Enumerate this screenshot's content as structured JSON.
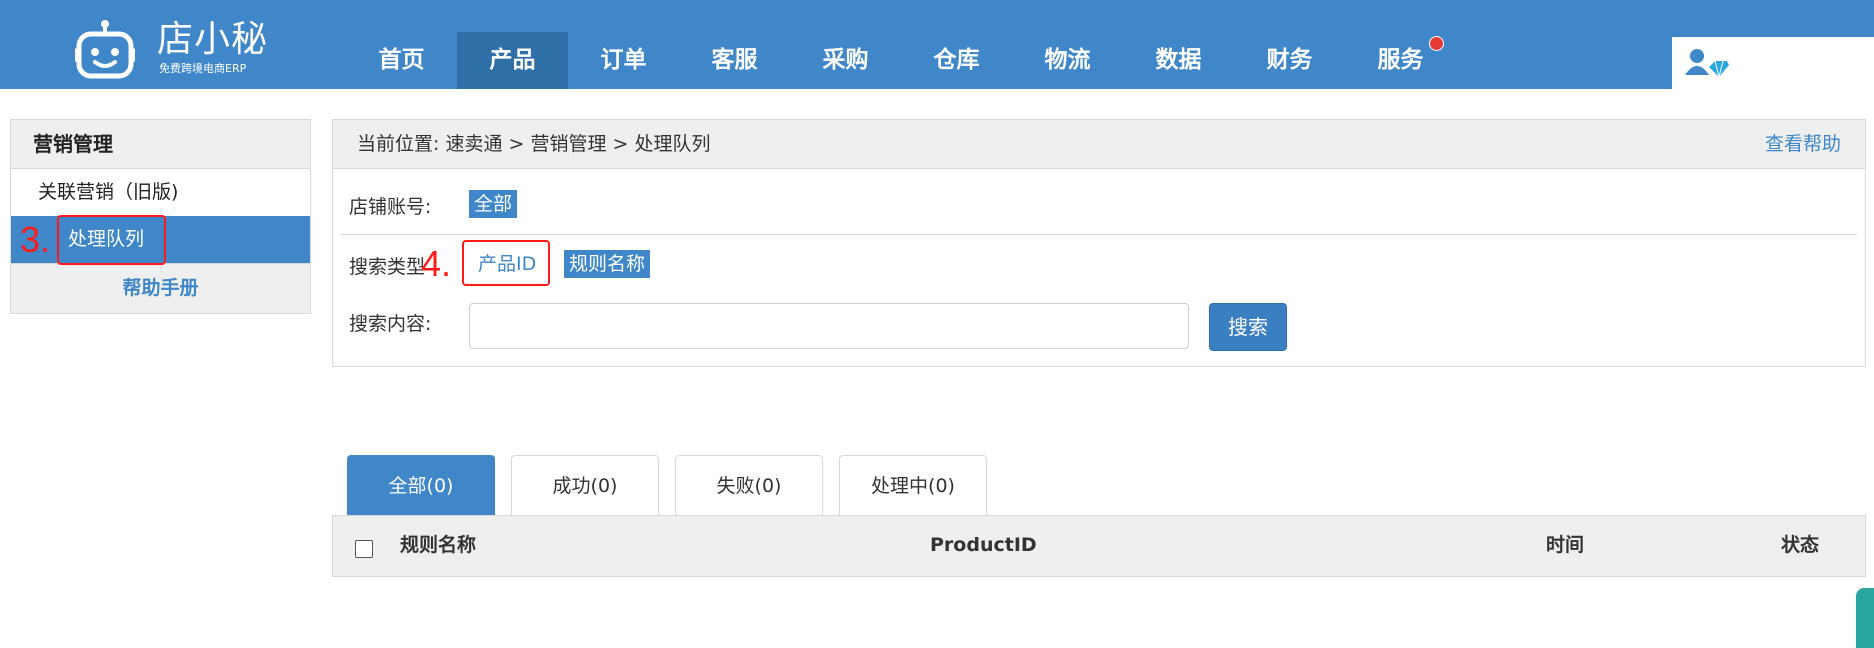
{
  "logo": {
    "name": "店小秘",
    "subtitle": "免费跨境电商ERP"
  },
  "nav": {
    "items": [
      {
        "label": "首页"
      },
      {
        "label": "产品"
      },
      {
        "label": "订单"
      },
      {
        "label": "客服"
      },
      {
        "label": "采购"
      },
      {
        "label": "仓库"
      },
      {
        "label": "物流"
      },
      {
        "label": "数据"
      },
      {
        "label": "财务"
      },
      {
        "label": "服务"
      }
    ],
    "active_index": 1,
    "badge_on": "服务"
  },
  "sidebar": {
    "title": "营销管理",
    "items": [
      {
        "label": "关联营销（旧版)"
      },
      {
        "label": "处理队列"
      }
    ],
    "active_index": 1,
    "help": "帮助手册"
  },
  "annotations": {
    "step3": "3.",
    "step4": "4."
  },
  "breadcrumb": {
    "text": "当前位置:   速卖通 > 营销管理 > 处理队列",
    "help_link": "查看帮助"
  },
  "filters": {
    "store_label": "店铺账号:",
    "store_value": "全部",
    "search_type_label": "搜索类型",
    "search_types": [
      "产品ID",
      "规则名称"
    ],
    "search_content_label": "搜索内容:",
    "search_input_value": "",
    "search_button": "搜索"
  },
  "tabs": [
    {
      "label": "全部(0)"
    },
    {
      "label": "成功(0)"
    },
    {
      "label": "失败(0)"
    },
    {
      "label": "处理中(0)"
    }
  ],
  "table": {
    "columns": [
      "规则名称",
      "ProductID",
      "时间",
      "状态"
    ]
  },
  "colors": {
    "brand": "#3f87c8",
    "annotation": "#ff1a1a",
    "badge": "#e53935"
  }
}
